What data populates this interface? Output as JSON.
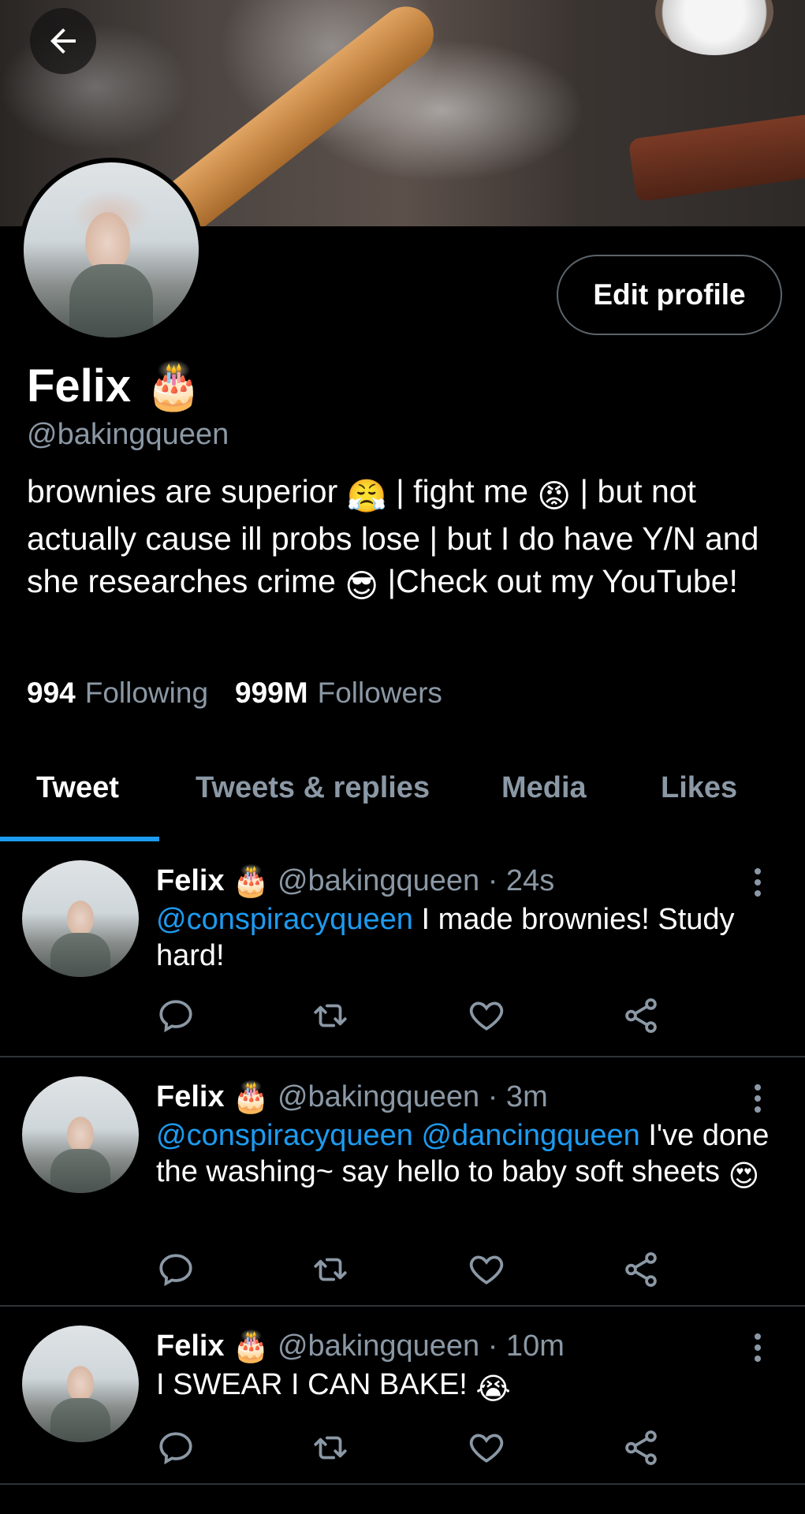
{
  "profile": {
    "display_name": "Felix",
    "name_emoji": "🎂",
    "handle": "@bakingqueen",
    "edit_label": "Edit profile",
    "bio_parts": {
      "p1": "brownies are superior ",
      "e1": "😤",
      "p2": " | fight me ",
      "e2": "😡",
      "p3": " | but not actually cause ill probs lose | but I do have Y/N and she researches crime ",
      "e3": "😎",
      "p4": " |Check out my YouTube!"
    },
    "following_count": "994",
    "following_label": "Following",
    "followers_count": "999M",
    "followers_label": "Followers"
  },
  "tabs": [
    {
      "label": "Tweet"
    },
    {
      "label": "Tweets & replies"
    },
    {
      "label": "Media"
    },
    {
      "label": "Likes"
    }
  ],
  "tweets": [
    {
      "name": "Felix",
      "emoji": "🎂",
      "meta": "@bakingqueen · 24s",
      "mention1": "@conspiracyqueen",
      "text": " I made brownies! Study hard!"
    },
    {
      "name": "Felix",
      "emoji": "🎂",
      "meta": "@bakingqueen · 3m",
      "mention1": "@conspiracyqueen",
      "mention2": " @dancingqueen",
      "text": " I've done the washing~ say hello to baby soft sheets ",
      "end_emoji": "😍"
    },
    {
      "name": "Felix",
      "emoji": "🎂",
      "meta": "@bakingqueen · 10m",
      "text": "I SWEAR I CAN BAKE! ",
      "end_emoji": "😭"
    }
  ],
  "icons": {
    "back": "arrow-left-icon",
    "reply": "reply-icon",
    "retweet": "retweet-icon",
    "like": "heart-icon",
    "share": "share-icon",
    "more": "more-vertical-icon"
  },
  "colors": {
    "background": "#000000",
    "accent": "#1d9bf0",
    "secondary_text": "#8b98a5",
    "divider": "#2f3336"
  }
}
